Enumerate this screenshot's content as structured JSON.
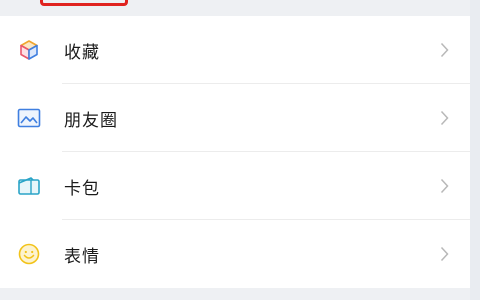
{
  "menu": {
    "items": [
      {
        "label": "收藏",
        "icon": "favorites-cube-icon"
      },
      {
        "label": "朋友圈",
        "icon": "moments-image-icon"
      },
      {
        "label": "卡包",
        "icon": "card-wallet-icon"
      },
      {
        "label": "表情",
        "icon": "emoji-smiley-icon"
      }
    ]
  },
  "colors": {
    "highlight": "#e0231f",
    "background": "#eef0f3",
    "card": "#ffffff",
    "chevron": "#b8b8b8"
  }
}
